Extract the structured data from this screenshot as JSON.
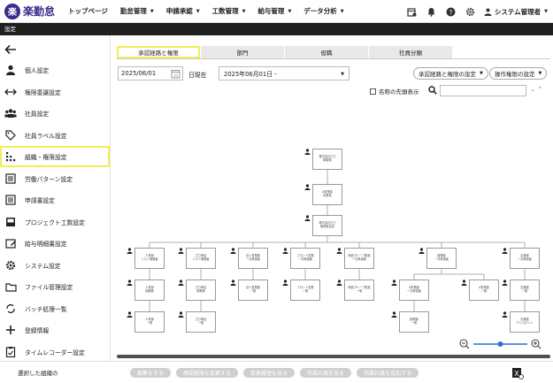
{
  "header": {
    "logo_mark": "楽",
    "logo_text": "楽勤怠",
    "nav": [
      {
        "label": "トップページ",
        "has_menu": false
      },
      {
        "label": "勤怠管理",
        "has_menu": true
      },
      {
        "label": "申請承認",
        "has_menu": true
      },
      {
        "label": "工数管理",
        "has_menu": true
      },
      {
        "label": "給与管理",
        "has_menu": true
      },
      {
        "label": "データ分析",
        "has_menu": true
      }
    ],
    "user_name": "システム管理者"
  },
  "subheader": {
    "title": "設定"
  },
  "sidebar": {
    "items": [
      {
        "label": "個人設定",
        "icon": "person-icon"
      },
      {
        "label": "権限委譲設定",
        "icon": "swap-arrows-icon"
      },
      {
        "label": "社員設定",
        "icon": "group-icon"
      },
      {
        "label": "社員ラベル設定",
        "icon": "tag-icon"
      },
      {
        "label": "組織・権限設定",
        "icon": "org-grid-icon",
        "active": true
      },
      {
        "label": "労働パターン設定",
        "icon": "list-icon"
      },
      {
        "label": "申請書設定",
        "icon": "list-icon"
      },
      {
        "label": "プロジェクト工数設定",
        "icon": "inbox-icon"
      },
      {
        "label": "給与明細書設定",
        "icon": "edit-card-icon"
      },
      {
        "label": "システム設定",
        "icon": "gear-icon"
      },
      {
        "label": "ファイル管理設定",
        "icon": "folder-icon"
      },
      {
        "label": "バッチ処理一覧",
        "icon": "cycle-icon"
      },
      {
        "label": "登録情報",
        "icon": "plus-icon"
      },
      {
        "label": "タイムレコーダー設定",
        "icon": "clipboard-icon"
      }
    ]
  },
  "tabs": [
    {
      "label": "承認経路と権限",
      "active": true
    },
    {
      "label": "部門",
      "active": false
    },
    {
      "label": "役職",
      "active": false
    },
    {
      "label": "社員分類",
      "active": false
    }
  ],
  "toolbar": {
    "date": "2025/06/01",
    "as_of_label": "日現在",
    "period": "2025年06月01日 -",
    "route_settings": "承認経路と権限の設定",
    "operation_settings": "操作権限の設定",
    "checkbox_label": "名称の先頭表示",
    "search_value": ""
  },
  "org_chart": {
    "root": [
      "株式会社〇〇",
      "取締役"
    ],
    "second": [
      "A事業部",
      "事業長"
    ],
    "third": [
      "株式会社〇〇",
      "取締役会長"
    ],
    "columns": [
      {
        "nodes": [
          [
            "人事部",
            "シスト管理者"
          ],
          [
            "人事部",
            "総務部"
          ],
          [
            "人事部",
            "一般"
          ]
        ]
      },
      {
        "nodes": [
          [
            "〇〇商店",
            "シスト管理者"
          ],
          [
            "〇〇商店",
            "総務部"
          ],
          [
            "〇〇商店",
            "一般"
          ]
        ]
      },
      {
        "nodes": [
          [
            "法人営業部",
            "一次承認者"
          ],
          [
            "法人営業部",
            "一般"
          ]
        ]
      },
      {
        "nodes": [
          [
            "フロント営業",
            "一次承認者"
          ],
          [
            "フロント営業",
            "一般"
          ]
        ]
      },
      {
        "nodes": [
          [
            "商品グループ推進",
            "一次承認者"
          ],
          [
            "商品グループ推進",
            "一般"
          ]
        ]
      },
      {
        "nodes": [
          [
            "経理部",
            "一次承認者"
          ],
          [
            "A事業部",
            "一次承認者"
          ],
          [
            "経理部",
            "一般"
          ],
          [
            "A事業部",
            "一般"
          ]
        ]
      },
      {
        "nodes": [
          [
            "広報室",
            "一次承認者"
          ],
          [
            "広報室",
            "一般"
          ],
          [
            "広報室",
            "アシスタント"
          ]
        ]
      }
    ]
  },
  "zoom": {
    "level": 0.5
  },
  "bottombar": {
    "selected_label": "選択した組織の",
    "buttons": [
      "編集をする",
      "承認経路を変更する",
      "変更履歴を見る",
      "所属社員を見る",
      "所属社員を追加する"
    ]
  }
}
